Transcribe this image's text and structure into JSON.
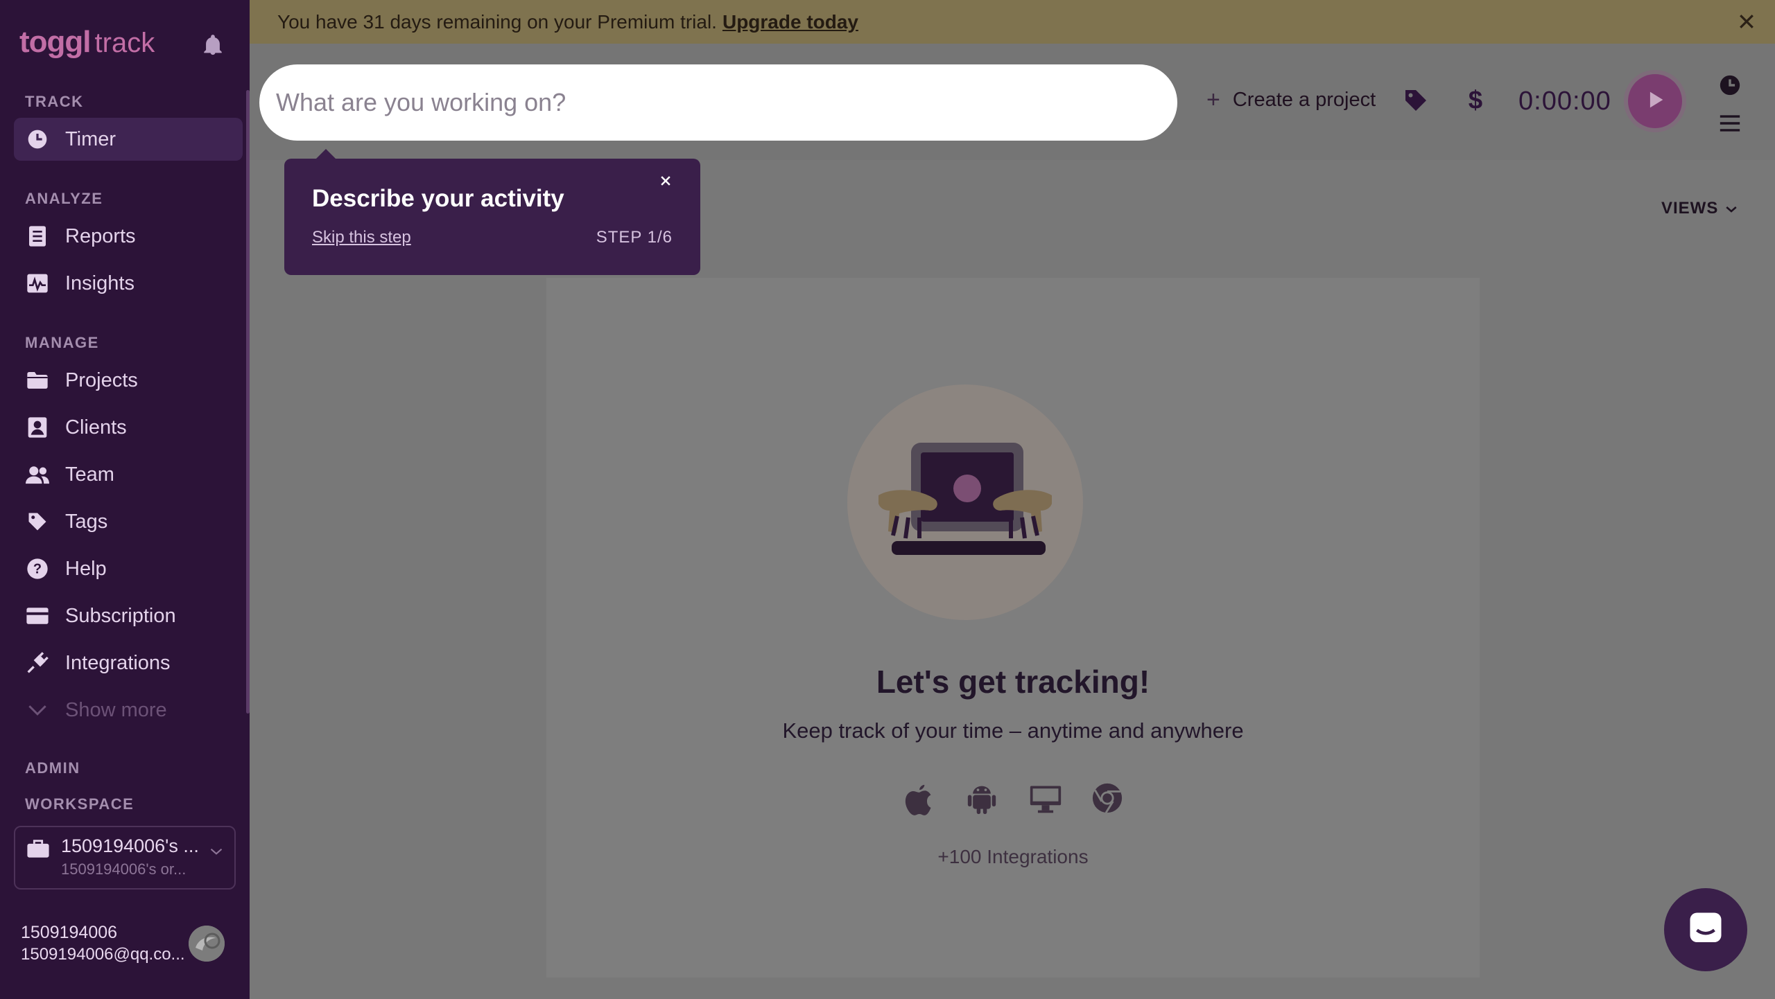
{
  "sidebar": {
    "logo_brand": "toggl",
    "logo_product": "track",
    "sections": {
      "track": "TRACK",
      "analyze": "ANALYZE",
      "manage": "MANAGE",
      "admin": "ADMIN",
      "workspace": "WORKSPACE"
    },
    "items": {
      "timer": "Timer",
      "reports": "Reports",
      "insights": "Insights",
      "projects": "Projects",
      "clients": "Clients",
      "team": "Team",
      "tags": "Tags",
      "help": "Help",
      "subscription": "Subscription",
      "integrations": "Integrations",
      "show_more": "Show more"
    },
    "workspace": {
      "name": "1509194006's ...",
      "org": "1509194006's or..."
    },
    "user": {
      "name": "1509194006",
      "email": "1509194006@qq.co..."
    }
  },
  "banner": {
    "text": "You have 31 days remaining on your Premium trial.",
    "link": "Upgrade today"
  },
  "topbar": {
    "placeholder": "What are you working on?",
    "create_project": "Create a project",
    "timer": "0:00:00"
  },
  "tooltip": {
    "title": "Describe your activity",
    "skip": "Skip this step",
    "step": "STEP 1/6"
  },
  "main": {
    "views": "VIEWS",
    "empty_title": "Let's get tracking!",
    "empty_subtitle": "Keep track of your time – anytime and anywhere",
    "integrations": "+100 Integrations"
  },
  "colors": {
    "sidebar_bg": "#2c1338",
    "accent": "#c26ea6",
    "banner_bg": "#7f734f",
    "tooltip_bg": "#3a1f4a"
  }
}
